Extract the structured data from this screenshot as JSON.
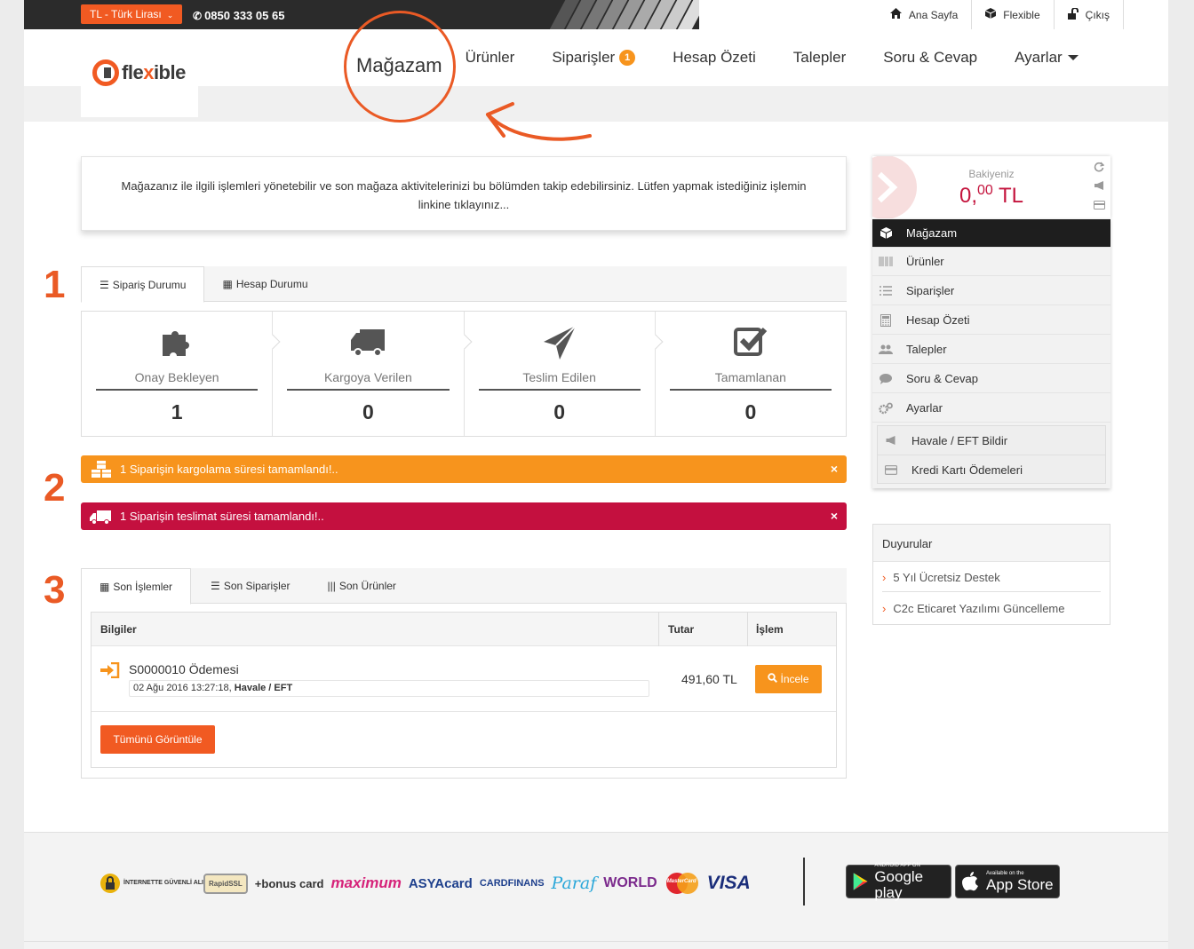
{
  "topbar": {
    "currency": "TL - Türk Lirası",
    "phone": "0850 333 05 65",
    "links": [
      {
        "icon": "home-icon",
        "label": "Ana Sayfa"
      },
      {
        "icon": "cube-icon",
        "label": "Flexible"
      },
      {
        "icon": "unlock-icon",
        "label": "Çıkış"
      }
    ]
  },
  "brand": {
    "logo_text_1": "fle",
    "logo_text_x": "x",
    "logo_text_2": "ible"
  },
  "nav": {
    "items": [
      "Mağazam",
      "Ürünler",
      "Siparişler",
      "Hesap Özeti",
      "Talepler",
      "Soru & Cevap",
      "Ayarlar"
    ],
    "orders_badge": "1"
  },
  "info": {
    "text": "Mağazanız ile ilgili işlemleri yönetebilir ve son mağaza aktivitelerinizi bu bölümden takip edebilirsiniz. Lütfen yapmak istediğiniz işlemin linkine tıklayınız..."
  },
  "steps": [
    "1",
    "2",
    "3"
  ],
  "status_tabs": [
    "Sipariş Durumu",
    "Hesap Durumu"
  ],
  "status_cards": [
    {
      "icon": "puzzle-icon",
      "label": "Onay Bekleyen",
      "value": "1"
    },
    {
      "icon": "truck-icon",
      "label": "Kargoya Verilen",
      "value": "0"
    },
    {
      "icon": "paper-plane-icon",
      "label": "Teslim Edilen",
      "value": "0"
    },
    {
      "icon": "check-square-icon",
      "label": "Tamamlanan",
      "value": "0"
    }
  ],
  "alerts": [
    {
      "icon": "cubes-icon",
      "text": "1 Siparişin kargolama süresi tamamlandı!..",
      "color": "#f7941d"
    },
    {
      "icon": "truck-icon",
      "text": "1 Siparişin teslimat süresi tamamlandı!..",
      "color": "#c4103f"
    }
  ],
  "activity_tabs": [
    "Son İşlemler",
    "Son Siparişler",
    "Son Ürünler"
  ],
  "transactions": {
    "headers": [
      "Bilgiler",
      "Tutar",
      "İşlem"
    ],
    "rows": [
      {
        "title": "S0000010 Ödemesi",
        "date": "02 Ağu 2016 13:27:18, ",
        "method": "Havale / EFT",
        "amount": "491,60 TL",
        "action": "İncele"
      }
    ],
    "view_all": "Tümünü Görüntüle"
  },
  "balance": {
    "label": "Bakiyeniz",
    "integer": "0,",
    "decimal": "00",
    "currency": " TL"
  },
  "sidebar": {
    "items": [
      {
        "icon": "cube-icon",
        "label": "Mağazam"
      },
      {
        "icon": "barcode-icon",
        "label": "Ürünler"
      },
      {
        "icon": "list-icon",
        "label": "Siparişler"
      },
      {
        "icon": "calculator-icon",
        "label": "Hesap Özeti"
      },
      {
        "icon": "users-icon",
        "label": "Talepler"
      },
      {
        "icon": "comment-icon",
        "label": "Soru & Cevap"
      },
      {
        "icon": "gears-icon",
        "label": "Ayarlar"
      }
    ],
    "sub_items": [
      {
        "icon": "bullhorn-icon",
        "label": "Havale / EFT Bildir"
      },
      {
        "icon": "credit-card-icon",
        "label": "Kredi Kartı Ödemeleri"
      }
    ]
  },
  "announcements": {
    "title": "Duyurular",
    "items": [
      "5 Yıl Ücretsiz Destek",
      "C2c Eticaret Yazılımı Güncelleme"
    ]
  },
  "footer": {
    "payment_logos": [
      "İNTERNETTE GÜVENLİ ALIŞVERİŞ",
      "RapidSSL",
      "+bonus card",
      "maximum",
      "ASYAcard",
      "CARDFINANS",
      "Paraf",
      "WORLD",
      "MasterCard",
      "VISA"
    ],
    "google_small": "ANDROID APP ON",
    "google_big": "Google play",
    "apple_small": "Available on the",
    "apple_big": "App Store"
  },
  "colors": {
    "accent": "#f15a22",
    "warning": "#f7941d",
    "danger": "#c4103f",
    "annotation": "#ea5a25"
  }
}
